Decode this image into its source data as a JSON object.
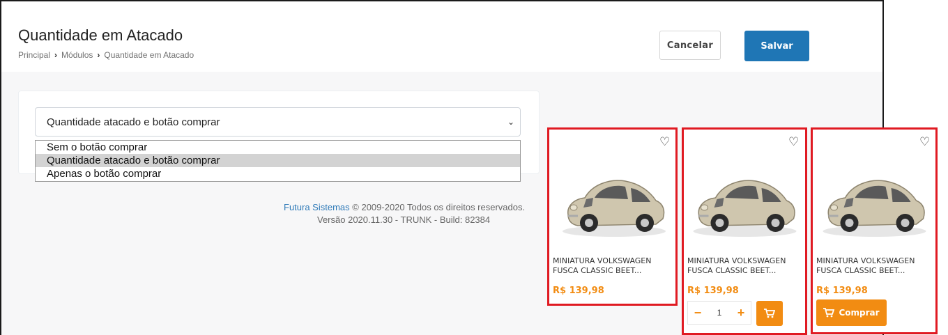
{
  "header": {
    "title": "Quantidade em Atacado",
    "breadcrumb": [
      "Principal",
      "Módulos",
      "Quantidade em Atacado"
    ],
    "cancel_label": "Cancelar",
    "save_label": "Salvar"
  },
  "select": {
    "value": "Quantidade atacado e botão comprar",
    "options": [
      "Sem o botão comprar",
      "Quantidade atacado e botão comprar",
      "Apenas o botão comprar"
    ]
  },
  "footer": {
    "brand": "Futura Sistemas",
    "copyright": "© 2009-2020 Todos os direitos reservados.",
    "version": "Versão 2020.11.30 - TRUNK - Build: 82384"
  },
  "products": [
    {
      "name_line1": "MINIATURA VOLKSWAGEN",
      "name_line2": "FUSCA CLASSIC BEET...",
      "price": "R$ 139,98"
    },
    {
      "name_line1": "MINIATURA VOLKSWAGEN",
      "name_line2": "FUSCA CLASSIC BEET...",
      "price": "R$ 139,98",
      "quantity": "1"
    },
    {
      "name_line1": "MINIATURA VOLKSWAGEN",
      "name_line2": "FUSCA CLASSIC BEET...",
      "price": "R$ 139,98",
      "buy_label": "Comprar"
    }
  ],
  "colors": {
    "accent": "#1f76b5",
    "price": "#f28c12",
    "highlight": "#e01a22"
  },
  "icons": [
    "chevron-down-icon",
    "chevron-right-icon",
    "heart-icon",
    "cart-icon",
    "minus-icon",
    "plus-icon"
  ]
}
